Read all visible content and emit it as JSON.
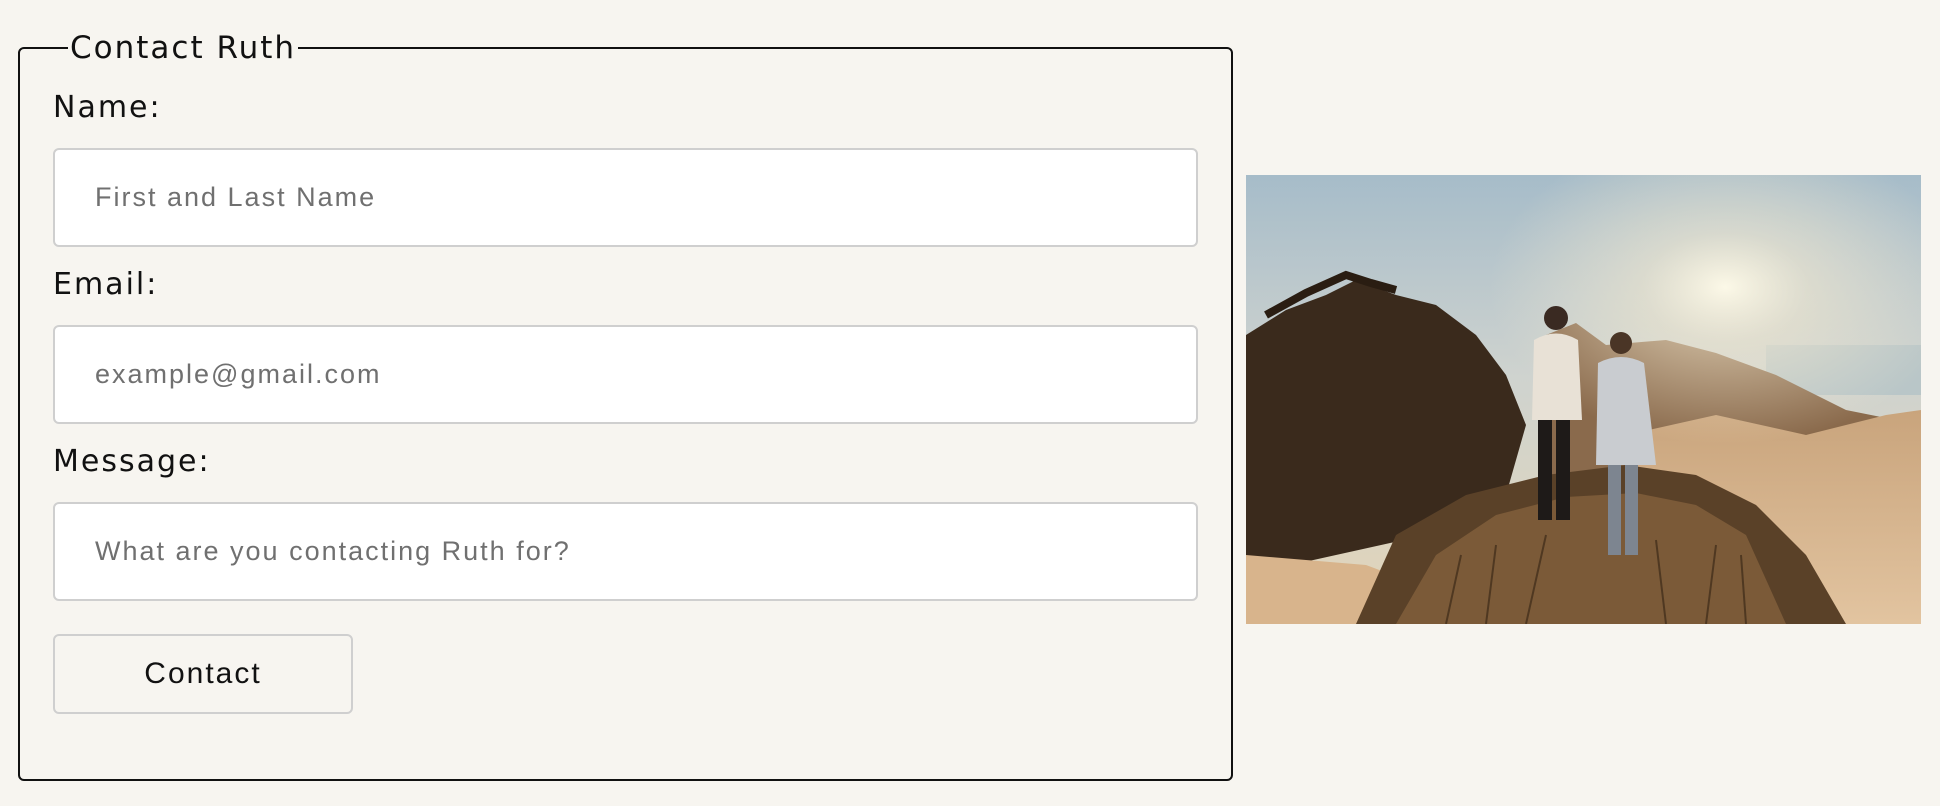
{
  "form": {
    "legend": "Contact Ruth",
    "name_label": "Name:",
    "name_placeholder": "First and Last Name",
    "name_value": "",
    "email_label": "Email:",
    "email_placeholder": "example@gmail.com",
    "email_value": "",
    "message_label": "Message:",
    "message_placeholder": "What are you contacting Ruth for?",
    "message_value": "",
    "submit_label": "Contact"
  },
  "photo": {
    "subject": "couple-standing-on-coastal-dunes-at-sunset"
  }
}
